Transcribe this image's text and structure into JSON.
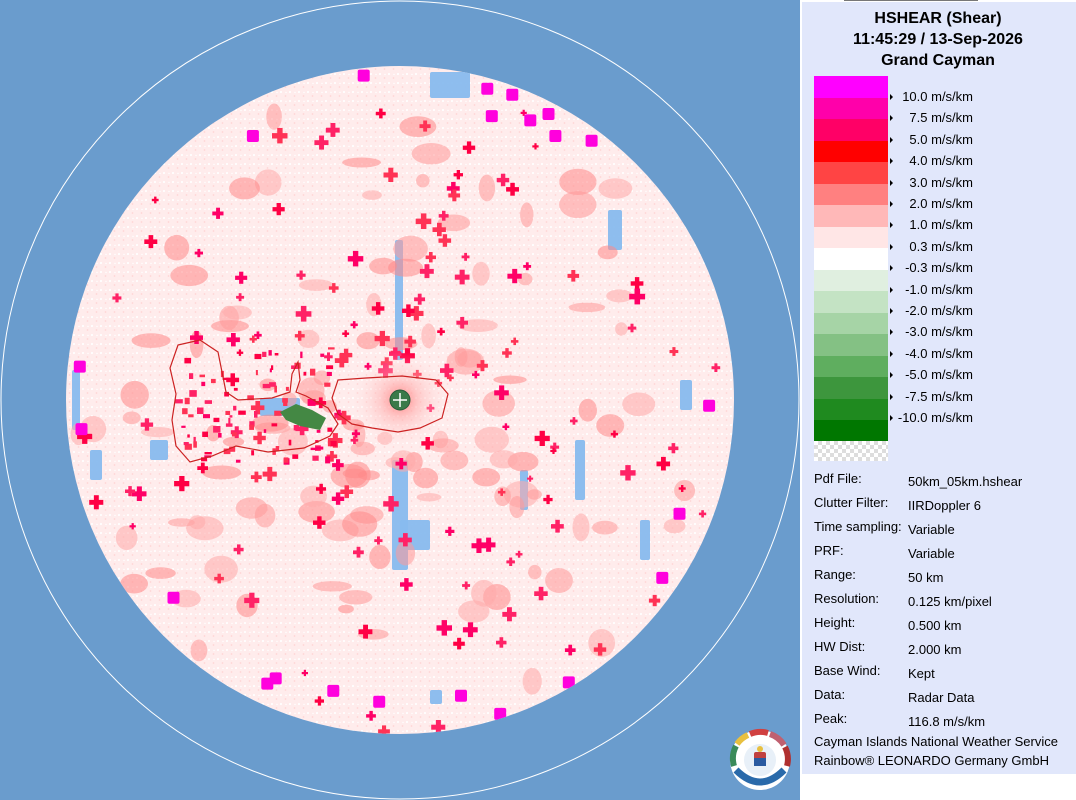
{
  "header": {
    "product": "HSHEAR (Shear)",
    "timestamp": "11:45:29 / 13-Sep-2026",
    "site": "Grand Cayman"
  },
  "legend": [
    {
      "label": "10.0 m/s/km",
      "color": "#ff00ff"
    },
    {
      "label": "7.5 m/s/km",
      "color": "#ff00aa"
    },
    {
      "label": "5.0 m/s/km",
      "color": "#ff0066"
    },
    {
      "label": "4.0 m/s/km",
      "color": "#ff0000"
    },
    {
      "label": "3.0 m/s/km",
      "color": "#ff4444"
    },
    {
      "label": "2.0 m/s/km",
      "color": "#ff8080"
    },
    {
      "label": "1.0 m/s/km",
      "color": "#ffb8b8"
    },
    {
      "label": "0.3 m/s/km",
      "color": "#ffe6e6"
    },
    {
      "label": "-0.3 m/s/km",
      "color": "#ffffff"
    },
    {
      "label": "-1.0 m/s/km",
      "color": "#e0efe0"
    },
    {
      "label": "-2.0 m/s/km",
      "color": "#c4e3c4"
    },
    {
      "label": "-3.0 m/s/km",
      "color": "#a6d4a6"
    },
    {
      "label": "-4.0 m/s/km",
      "color": "#84c184"
    },
    {
      "label": "-5.0 m/s/km",
      "color": "#5fae5f"
    },
    {
      "label": "-7.5 m/s/km",
      "color": "#3d963d"
    },
    {
      "label": "-10.0 m/s/km",
      "color": "#1f8a1f"
    },
    {
      "label": "",
      "color": "#007700"
    }
  ],
  "info": [
    {
      "key": "Pdf File:",
      "value": "50km_05km.hshear"
    },
    {
      "key": "Clutter Filter:",
      "value": "IIRDoppler 6"
    },
    {
      "key": "Time sampling:",
      "value": "Variable"
    },
    {
      "key": "PRF:",
      "value": "Variable"
    },
    {
      "key": "Range:",
      "value": "50 km"
    },
    {
      "key": "Resolution:",
      "value": "0.125 km/pixel"
    },
    {
      "key": "Height:",
      "value": "0.500 km"
    },
    {
      "key": "HW Dist:",
      "value": "2.000 km"
    },
    {
      "key": "Base Wind:",
      "value": "Kept"
    },
    {
      "key": "Data:",
      "value": "Radar Data"
    },
    {
      "key": "Peak:",
      "value": "116.8 m/s/km"
    }
  ],
  "footer": {
    "line1": "Cayman Islands National Weather Service",
    "line2": "Rainbow® LEONARDO Germany GmbH"
  },
  "colors": {
    "background": "#6a9ccd",
    "panel": "#e1e7fb",
    "radar_base": "#ffeeee",
    "no_data": "#88bbee",
    "coast": "#cc2222",
    "land_green": "#448844",
    "radar_site": "#3a7a4a"
  },
  "icons": {
    "radar_site": "radar-site-marker-icon",
    "logo": "cayman-nws-logo"
  }
}
